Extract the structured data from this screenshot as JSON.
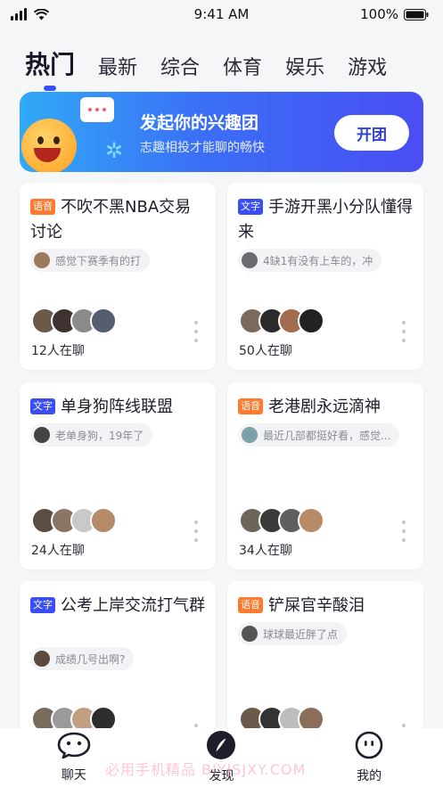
{
  "status": {
    "time": "9:41 AM",
    "battery": "100%"
  },
  "tabs": [
    {
      "label": "热门",
      "active": true
    },
    {
      "label": "最新",
      "active": false
    },
    {
      "label": "综合",
      "active": false
    },
    {
      "label": "体育",
      "active": false
    },
    {
      "label": "娱乐",
      "active": false
    },
    {
      "label": "游戏",
      "active": false
    }
  ],
  "banner": {
    "title": "发起你的兴趣团",
    "subtitle": "志趣相投才能聊的畅快",
    "button": "开团"
  },
  "cards": [
    {
      "tag": "语音",
      "tag_type": "voice",
      "title": "不吹不黑NBA交易讨论",
      "preview": "感觉下赛季有的打",
      "count": "12人在聊"
    },
    {
      "tag": "文字",
      "tag_type": "text",
      "title": "手游开黑小分队懂得来",
      "preview": "4缺1有没有上车的，冲",
      "count": "50人在聊"
    },
    {
      "tag": "文字",
      "tag_type": "text",
      "title": "单身狗阵线联盟",
      "preview": "老单身狗，19年了",
      "count": "24人在聊"
    },
    {
      "tag": "语音",
      "tag_type": "voice",
      "title": "老港剧永远滴神",
      "preview": "最近几部都挺好看，感觉...",
      "count": "34人在聊"
    },
    {
      "tag": "文字",
      "tag_type": "text",
      "title": "公考上岸交流打气群",
      "preview": "成绩几号出啊?",
      "count": ""
    },
    {
      "tag": "语音",
      "tag_type": "voice",
      "title": "铲屎官辛酸泪",
      "preview": "球球最近胖了点",
      "count": ""
    }
  ],
  "nav": [
    {
      "label": "聊天",
      "icon": "chat-icon",
      "active": false
    },
    {
      "label": "发现",
      "icon": "discover-icon",
      "active": true
    },
    {
      "label": "我的",
      "icon": "profile-icon",
      "active": false
    }
  ],
  "watermark": "必用手机精品 BIYJSJXY.COM",
  "colors": {
    "accent": "#3b4ef6",
    "voice_tag": "#ff7a2f",
    "text_tag": "#3b4ef6"
  }
}
